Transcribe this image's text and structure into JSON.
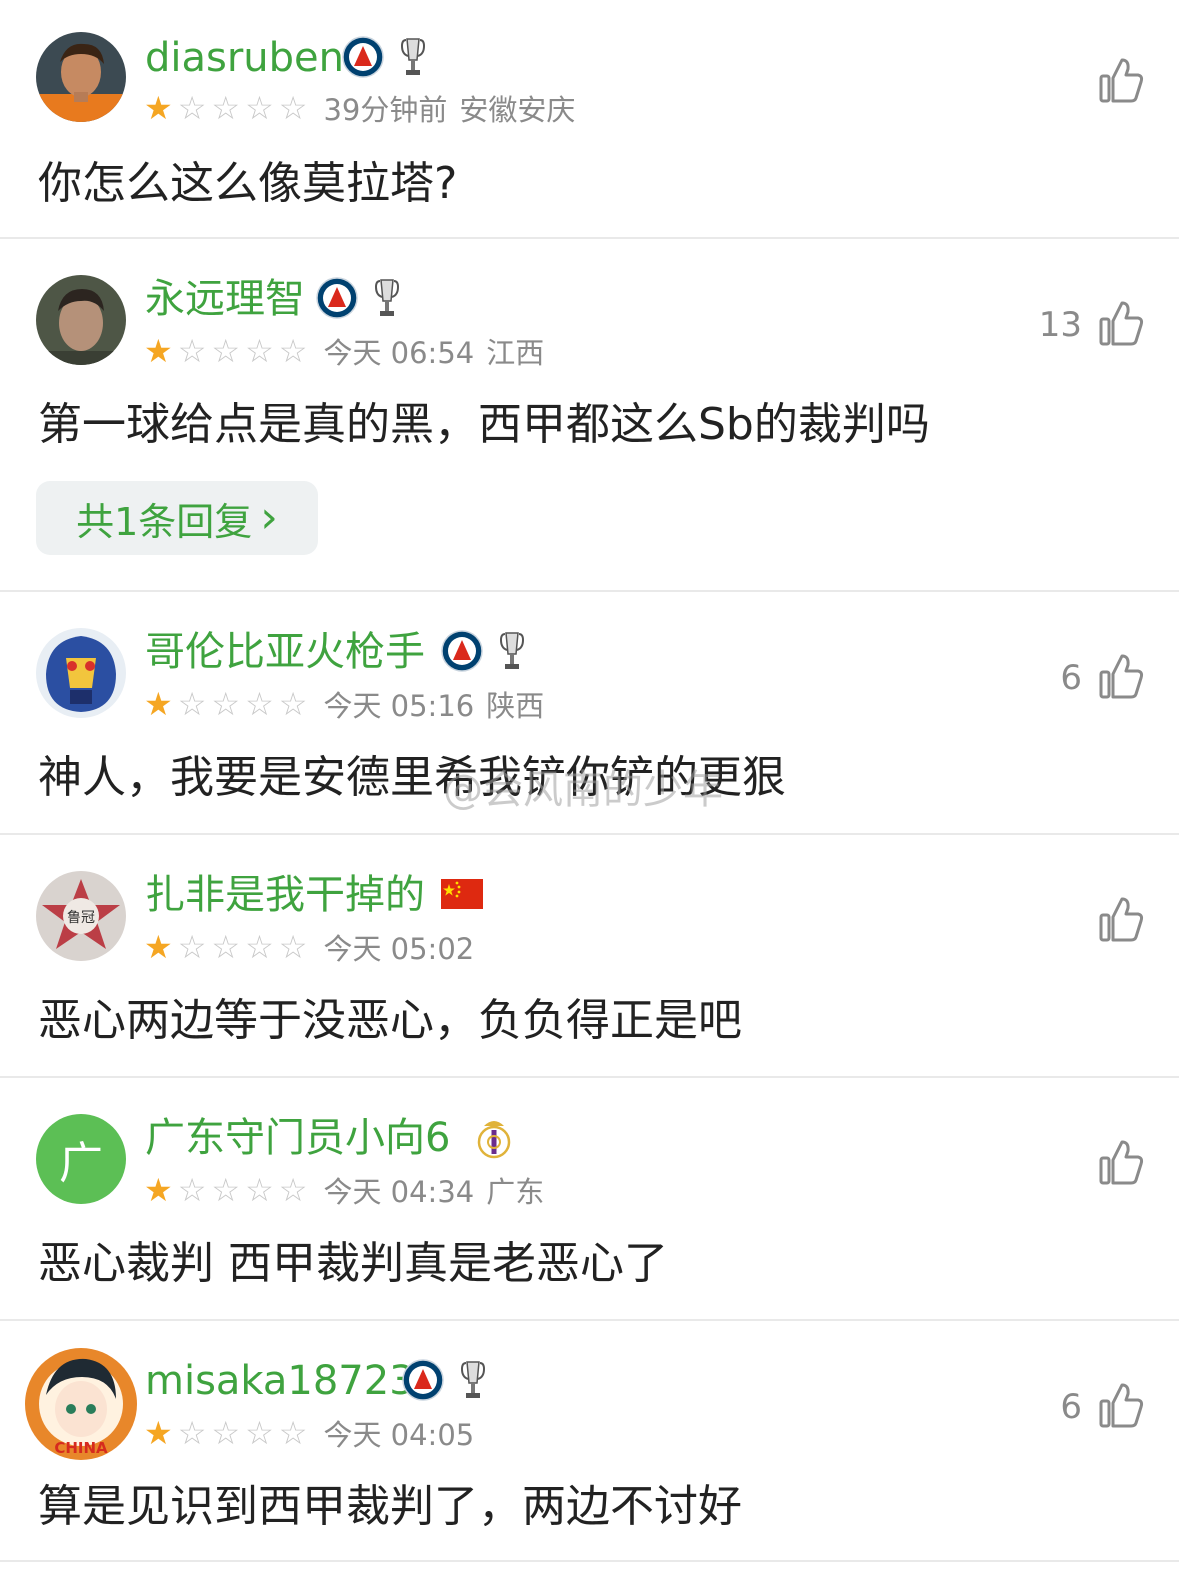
{
  "comments": [
    {
      "username": "diasruben",
      "rating": 1,
      "time": "39分钟前",
      "location": "安徽安庆",
      "text": "你怎么这么像莫拉塔?",
      "likes": "",
      "badges": [
        "psg-badge-icon",
        "trophy-icon"
      ]
    },
    {
      "username": "永远理智",
      "rating": 1,
      "time": "今天 06:54",
      "location": "江西",
      "text": "第一球给点是真的黑，西甲都这么Sb的裁判吗",
      "likes": "13",
      "badges": [
        "psg-badge-icon",
        "trophy-icon"
      ],
      "reply_label": "共1条回复",
      "reply_chevron": "›"
    },
    {
      "username": "哥伦比亚火枪手",
      "rating": 1,
      "time": "今天 05:16",
      "location": "陕西",
      "text": "神人，我要是安德里希我铲你铲的更狠",
      "likes": "6",
      "badges": [
        "psg-badge-icon",
        "trophy-icon"
      ]
    },
    {
      "username": "扎非是我干掉的",
      "rating": 1,
      "time": "今天 05:02",
      "location": "",
      "text": "恶心两边等于没恶心，负负得正是吧",
      "likes": "",
      "badges": [
        "china-flag-icon"
      ]
    },
    {
      "username": "广东守门员小向6",
      "rating": 1,
      "time": "今天 04:34",
      "location": "广东",
      "text": "恶心裁判 西甲裁判真是老恶心了",
      "likes": "",
      "badges": [
        "real-madrid-badge-icon"
      ],
      "avatar_text": "广"
    },
    {
      "username": "misaka18723",
      "rating": 1,
      "time": "今天 04:05",
      "location": "",
      "text": "算是见识到西甲裁判了，两边不讨好",
      "likes": "6",
      "badges": [
        "psg-badge-icon",
        "trophy-icon"
      ]
    }
  ],
  "avatar_labels": {
    "c3": "鲁冠",
    "c5": "CHINA"
  },
  "watermark": "@会风南的少年",
  "colors": {
    "username": "#3fa33f",
    "star_on": "#f5a623",
    "star_off": "#c8c8c8",
    "meta": "#8a8a8a",
    "psg_blue": "#004170",
    "psg_red": "#da291c"
  }
}
